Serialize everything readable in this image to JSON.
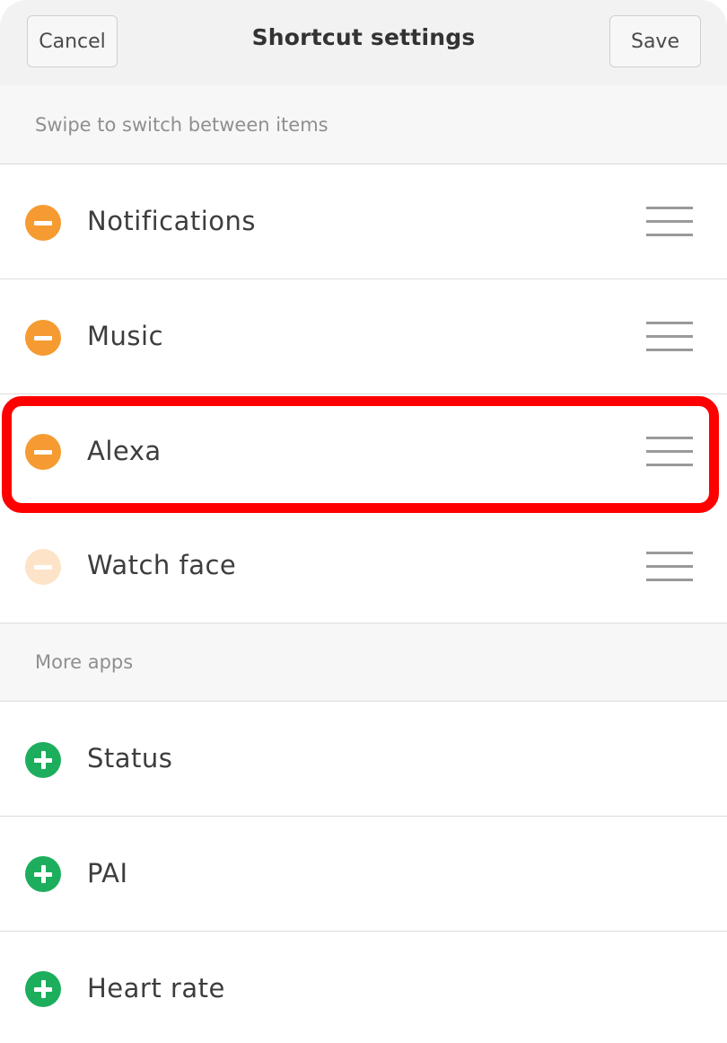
{
  "header": {
    "cancel_label": "Cancel",
    "title": "Shortcut settings",
    "save_label": "Save"
  },
  "active_section": {
    "hint": "Swipe to switch between items",
    "items": [
      {
        "label": "Notifications",
        "icon": "remove-circle-icon"
      },
      {
        "label": "Music",
        "icon": "remove-circle-icon"
      },
      {
        "label": "Alexa",
        "icon": "remove-circle-icon",
        "highlighted": true
      },
      {
        "label": "Watch face",
        "icon": "remove-circle-icon",
        "disabled": true
      }
    ]
  },
  "more_section": {
    "title": "More apps",
    "items": [
      {
        "label": "Status",
        "icon": "add-circle-icon"
      },
      {
        "label": "PAI",
        "icon": "add-circle-icon"
      },
      {
        "label": "Heart rate",
        "icon": "add-circle-icon"
      }
    ]
  },
  "colors": {
    "remove": "#f59b32",
    "remove_disabled": "#fde3c8",
    "add": "#1dae5d",
    "highlight": "#ff0000"
  }
}
